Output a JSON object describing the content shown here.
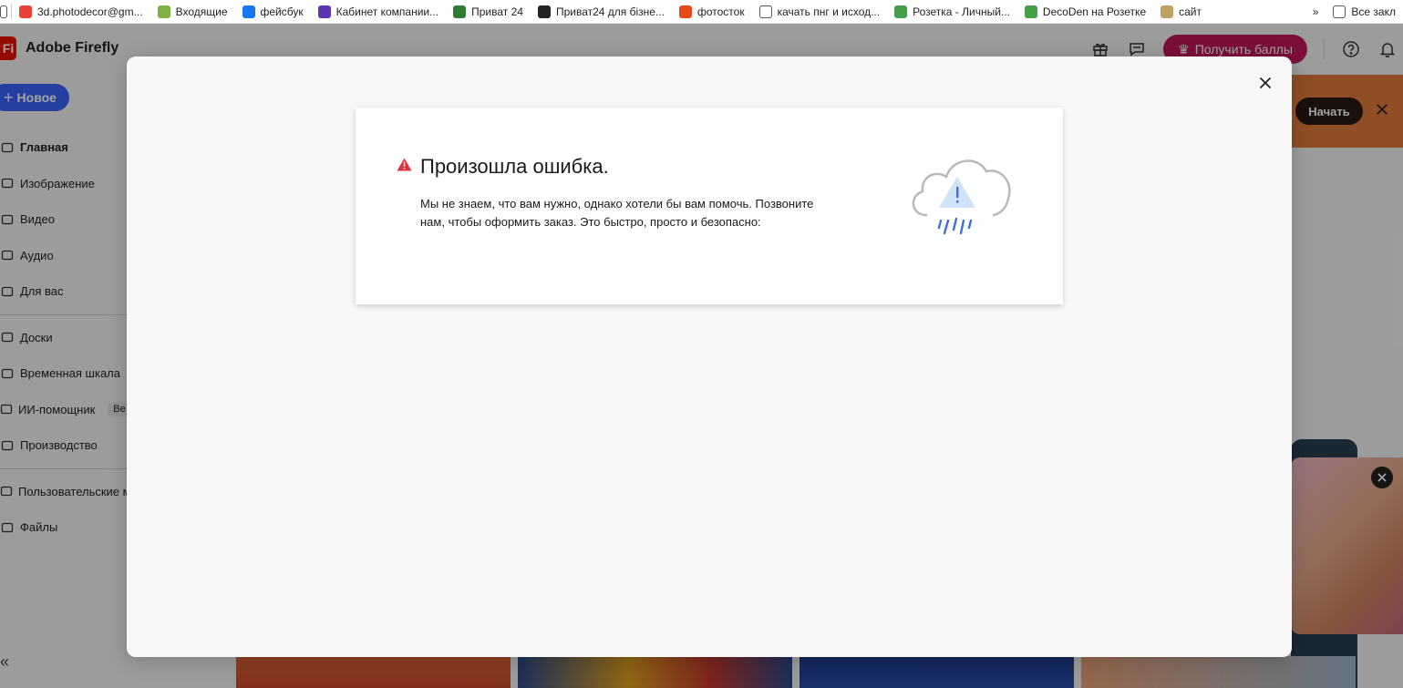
{
  "bookmarks": [
    {
      "label": "3d.photodecor@gm...",
      "icon": "gmail-icon",
      "color": "#ea4335"
    },
    {
      "label": "Входящие",
      "icon": "mail-icon",
      "color": "#7cb342"
    },
    {
      "label": "фейсбук",
      "icon": "facebook-icon",
      "color": "#1877f2"
    },
    {
      "label": "Кабинет компании...",
      "icon": "company-icon",
      "color": "#5e35b1"
    },
    {
      "label": "Приват 24",
      "icon": "privat-icon",
      "color": "#2e7d32"
    },
    {
      "label": "Приват24 для бізне...",
      "icon": "privat-business-icon",
      "color": "#222222"
    },
    {
      "label": "фотосток",
      "icon": "photostock-icon",
      "color": "#e64a19"
    },
    {
      "label": "качать пнг и исход...",
      "icon": "page-icon",
      "color": "#ffffff"
    },
    {
      "label": "Розетка - Личный...",
      "icon": "rozetka-icon",
      "color": "#43a047"
    },
    {
      "label": "DecoDen на Розетке",
      "icon": "rozetka-icon",
      "color": "#43a047"
    },
    {
      "label": "сайт",
      "icon": "site-icon",
      "color": "#c0a060"
    }
  ],
  "bookmarks_more": "»",
  "bookmarks_all": "Все закл",
  "app": {
    "brand_logo": "Fi",
    "brand_name": "Adobe Firefly",
    "points_button": "Получить баллы",
    "new_button": "Новое",
    "nav": [
      {
        "label": "Главная",
        "icon": "home-icon",
        "active": true
      },
      {
        "label": "Изображение",
        "icon": "image-icon"
      },
      {
        "label": "Видео",
        "icon": "video-icon"
      },
      {
        "label": "Аудио",
        "icon": "audio-icon"
      },
      {
        "label": "Для вас",
        "icon": "for-you-icon"
      }
    ],
    "nav2": [
      {
        "label": "Доски",
        "icon": "boards-icon"
      },
      {
        "label": "Временная шкала",
        "icon": "timeline-icon"
      },
      {
        "label": "ИИ-помощник",
        "icon": "ai-assistant-icon",
        "badge": "Be"
      },
      {
        "label": "Производство",
        "icon": "production-icon"
      }
    ],
    "nav3": [
      {
        "label": "Пользовательские м",
        "icon": "custom-models-icon"
      },
      {
        "label": "Файлы",
        "icon": "folder-icon"
      }
    ],
    "collapse_label": "«",
    "banner_button": "Начать"
  },
  "modal": {
    "title": "Произошла ошибка.",
    "message": "Мы не знаем, что вам нужно, однако хотели бы вам помочь. Позвоните нам, чтобы оформить заказ. Это быстро, просто и безопасно:",
    "accent_color": "#d7373f"
  }
}
